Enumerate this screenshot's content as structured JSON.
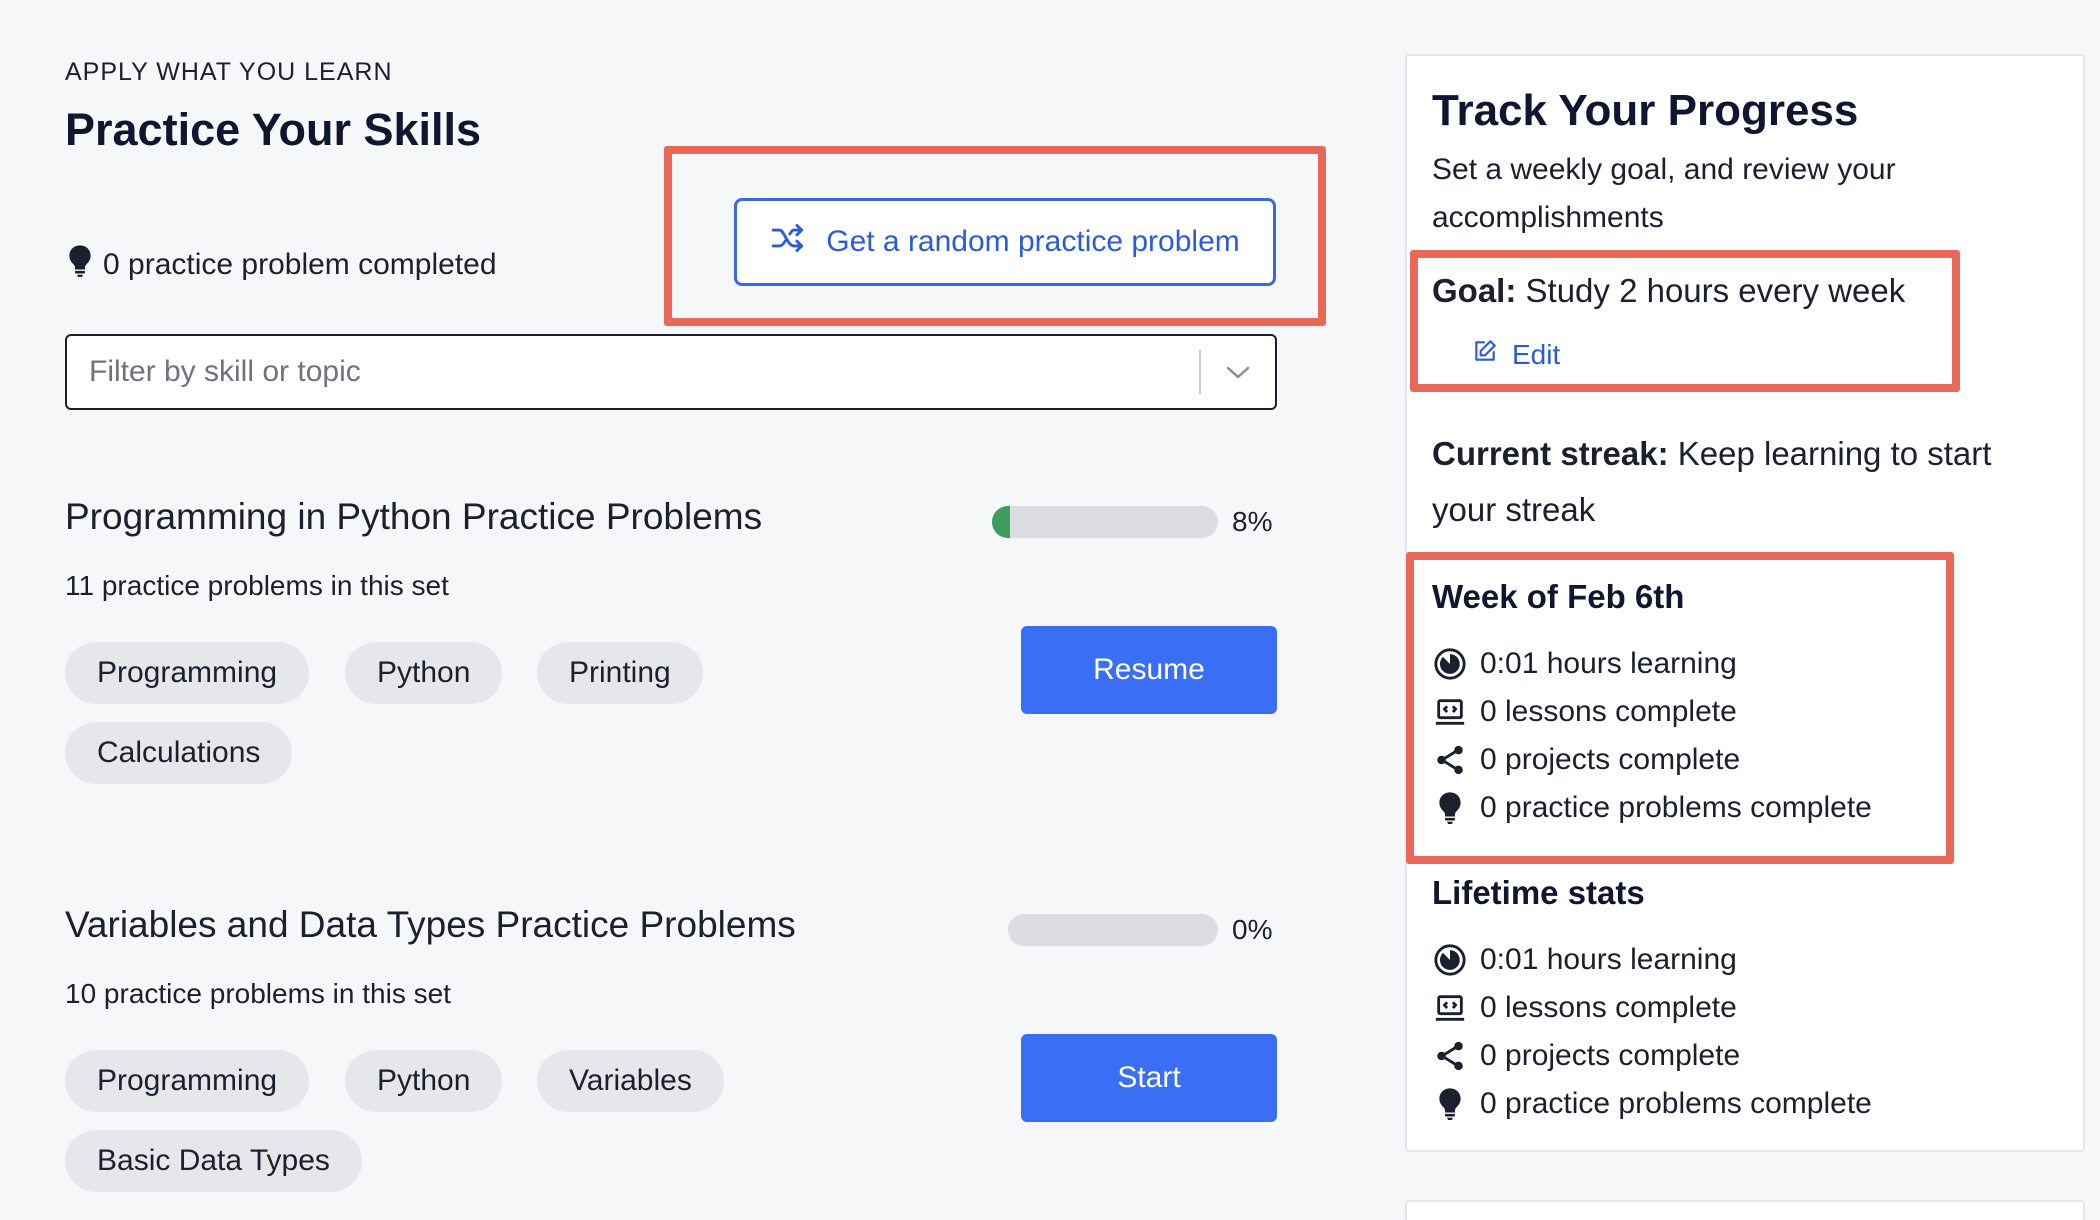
{
  "left": {
    "eyebrow": "APPLY WHAT YOU LEARN",
    "title": "Practice Your Skills",
    "random_button": "Get a random practice problem",
    "completed_text": "0 practice problem completed",
    "filter_placeholder": "Filter by skill or topic",
    "sets": [
      {
        "title": "Programming in Python Practice Problems",
        "count_text": "11 practice problems in this set",
        "progress": 0.08,
        "progress_label": "8%",
        "tags": [
          "Programming",
          "Python",
          "Printing",
          "Calculations"
        ],
        "button": "Resume"
      },
      {
        "title": "Variables and Data Types Practice Problems",
        "count_text": "10 practice problems in this set",
        "progress": 0,
        "progress_label": "0%",
        "tags": [
          "Programming",
          "Python",
          "Variables",
          "Basic Data Types"
        ],
        "button": "Start"
      }
    ]
  },
  "right": {
    "title": "Track Your Progress",
    "subtitle": "Set a weekly goal, and review your accomplishments",
    "goal_label": "Goal:",
    "goal_value": "Study 2 hours every week",
    "edit_label": "Edit",
    "streak_label": "Current streak:",
    "streak_value": "Keep learning to start your streak",
    "week": {
      "title": "Week of Feb 6th",
      "stats": [
        {
          "icon": "clock-icon",
          "text": "0:01 hours learning"
        },
        {
          "icon": "laptop-icon",
          "text": "0 lessons complete"
        },
        {
          "icon": "share-icon",
          "text": "0 projects complete"
        },
        {
          "icon": "lightbulb-icon",
          "text": "0 practice problems complete"
        }
      ]
    },
    "lifetime": {
      "title": "Lifetime stats",
      "stats": [
        {
          "icon": "clock-icon",
          "text": "0:01 hours learning"
        },
        {
          "icon": "laptop-icon",
          "text": "0 lessons complete"
        },
        {
          "icon": "share-icon",
          "text": "0 projects complete"
        },
        {
          "icon": "lightbulb-icon",
          "text": "0 practice problems complete"
        }
      ]
    }
  },
  "colors": {
    "accent": "#3a6ef5",
    "highlight": "#e8685a",
    "progress_fill": "#3e9c5f"
  }
}
